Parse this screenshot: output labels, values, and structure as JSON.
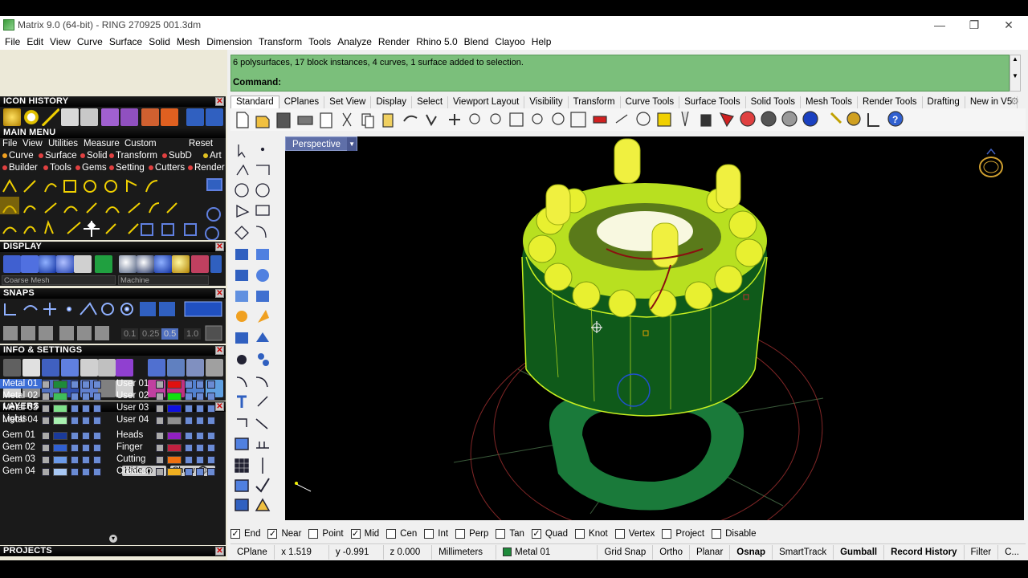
{
  "window": {
    "title": "Matrix 9.0 (64-bit) - RING 270925 001.3dm",
    "minimize": "—",
    "restore": "❐",
    "close": "✕"
  },
  "menubar": [
    "File",
    "Edit",
    "View",
    "Curve",
    "Surface",
    "Solid",
    "Mesh",
    "Dimension",
    "Transform",
    "Tools",
    "Analyze",
    "Render",
    "Rhino 5.0",
    "Blend",
    "Clayoo",
    "Help"
  ],
  "command": {
    "history": "6 polysurfaces, 17 block instances, 4 curves, 1 surface added to selection.",
    "prompt": "Command:"
  },
  "tabs": [
    "Standard",
    "CPlanes",
    "Set View",
    "Display",
    "Select",
    "Viewport Layout",
    "Visibility",
    "Transform",
    "Curve Tools",
    "Surface Tools",
    "Solid Tools",
    "Mesh Tools",
    "Render Tools",
    "Drafting",
    "New in V5"
  ],
  "viewport": {
    "label": "Perspective"
  },
  "left": {
    "icon_history": "ICON HISTORY",
    "main_menu": "MAIN MENU",
    "mm_row1": [
      "File",
      "View",
      "Utilities",
      "Measure",
      "Custom"
    ],
    "mm_reset": "Reset",
    "mm_row2": [
      {
        "label": "Curve",
        "color": "#f0a020"
      },
      {
        "label": "Surface",
        "color": "#e04040"
      },
      {
        "label": "Solid",
        "color": "#e04040"
      },
      {
        "label": "Transform",
        "color": "#e04040"
      },
      {
        "label": "SubD",
        "color": "#e04040"
      },
      {
        "label": "Art",
        "color": "#e0c020"
      }
    ],
    "mm_row3": [
      {
        "label": "Builder",
        "color": "#e04040"
      },
      {
        "label": "Tools",
        "color": "#e04040"
      },
      {
        "label": "Gems",
        "color": "#e04040"
      },
      {
        "label": "Setting",
        "color": "#e04040"
      },
      {
        "label": "Cutters",
        "color": "#e04040"
      },
      {
        "label": "Render",
        "color": "#e04040"
      }
    ],
    "display": "DISPLAY",
    "display_mesh": "Coarse Mesh",
    "display_material": "Machine",
    "snaps": "SNAPS",
    "snap_values": [
      "0.1",
      "0.25",
      "0.5",
      "1.0"
    ],
    "info": "INFO & SETTINGS",
    "layers": "LAYERS",
    "lights": "Lights",
    "hide": "Hide",
    "show": "Show",
    "layers_left": [
      {
        "name": "Metal 01",
        "color": "#1e8a3a",
        "selected": true
      },
      {
        "name": "Metal 02",
        "color": "#3fbf5a",
        "selected": false
      },
      {
        "name": "Metal 03",
        "color": "#7fe08a",
        "selected": false
      },
      {
        "name": "Metal 04",
        "color": "#a8f0b0",
        "selected": false
      },
      {
        "name": "Gem 01",
        "color": "#1a3a9a",
        "selected": false
      },
      {
        "name": "Gem 02",
        "color": "#3060d0",
        "selected": false
      },
      {
        "name": "Gem 03",
        "color": "#6a9ae8",
        "selected": false
      },
      {
        "name": "Gem 04",
        "color": "#a8c8f4",
        "selected": false
      }
    ],
    "layers_right": [
      {
        "name": "User 01",
        "color": "#e01010"
      },
      {
        "name": "User 02",
        "color": "#10e010"
      },
      {
        "name": "User 03",
        "color": "#1010e0"
      },
      {
        "name": "User 04",
        "color": "#909090"
      },
      {
        "name": "Heads",
        "color": "#9020c0"
      },
      {
        "name": "Finger",
        "color": "#c02040"
      },
      {
        "name": "Cutting",
        "color": "#f07010"
      },
      {
        "name": "Creation",
        "color": "#f0b020"
      }
    ],
    "projects": "PROJECTS"
  },
  "osnaps": [
    {
      "label": "End",
      "checked": true
    },
    {
      "label": "Near",
      "checked": true
    },
    {
      "label": "Point",
      "checked": false
    },
    {
      "label": "Mid",
      "checked": true
    },
    {
      "label": "Cen",
      "checked": false
    },
    {
      "label": "Int",
      "checked": false
    },
    {
      "label": "Perp",
      "checked": false
    },
    {
      "label": "Tan",
      "checked": false
    },
    {
      "label": "Quad",
      "checked": true
    },
    {
      "label": "Knot",
      "checked": false
    },
    {
      "label": "Vertex",
      "checked": false
    },
    {
      "label": "Project",
      "checked": false
    },
    {
      "label": "Disable",
      "checked": false
    }
  ],
  "status": {
    "cplane": "CPlane",
    "x": "x 1.519",
    "y": "y -0.991",
    "z": "z 0.000",
    "units": "Millimeters",
    "layer": "Metal 01",
    "layer_color": "#1e8a3a",
    "grid_snap": "Grid Snap",
    "ortho": "Ortho",
    "planar": "Planar",
    "osnap": "Osnap",
    "smarttrack": "SmartTrack",
    "gumball": "Gumball",
    "record_history": "Record History",
    "filter": "Filter",
    "more": "C..."
  }
}
